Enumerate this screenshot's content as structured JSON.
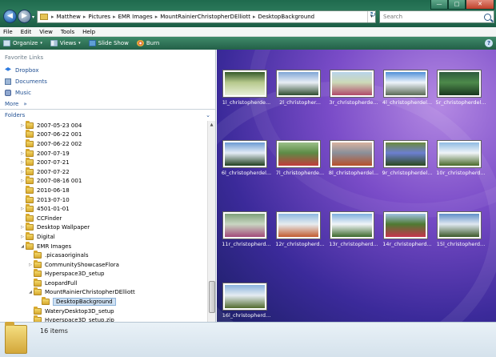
{
  "window": {
    "min_label": "—",
    "max_label": "□",
    "close_label": "✕"
  },
  "nav": {
    "back_glyph": "◀",
    "forward_glyph": "▶",
    "dropdown_glyph": "▾"
  },
  "address": {
    "crumbs": [
      "Matthew",
      "Pictures",
      "EMR Images",
      "MountRainierChristopherDElliott",
      "DesktopBackground"
    ],
    "separator": "▸",
    "dropdown_glyph": "▾",
    "refresh_glyph": "↻"
  },
  "search": {
    "placeholder": "Search"
  },
  "menu": {
    "items": [
      "File",
      "Edit",
      "View",
      "Tools",
      "Help"
    ]
  },
  "toolbar": {
    "organize": "Organize",
    "views": "Views",
    "slideshow": "Slide Show",
    "burn": "Burn",
    "arrow": "▾",
    "help": "?"
  },
  "favorites": {
    "header": "Favorite Links",
    "items": [
      {
        "label": "Dropbox",
        "icon": "dropbox-icon"
      },
      {
        "label": "Documents",
        "icon": "documents-icon"
      },
      {
        "label": "Music",
        "icon": "music-icon"
      }
    ],
    "more": "More",
    "more_arrow": "»"
  },
  "folders": {
    "header": "Folders",
    "chevron": "⌄",
    "tree": [
      {
        "label": "2007-05-23 004",
        "depth": 2,
        "expander": "▷"
      },
      {
        "label": "2007-06-22 001",
        "depth": 2,
        "expander": ""
      },
      {
        "label": "2007-06-22 002",
        "depth": 2,
        "expander": ""
      },
      {
        "label": "2007-07-19",
        "depth": 2,
        "expander": "▷"
      },
      {
        "label": "2007-07-21",
        "depth": 2,
        "expander": "▷"
      },
      {
        "label": "2007-07-22",
        "depth": 2,
        "expander": "▷"
      },
      {
        "label": "2007-08-16 001",
        "depth": 2,
        "expander": "▷"
      },
      {
        "label": "2010-06-18",
        "depth": 2,
        "expander": ""
      },
      {
        "label": "2013-07-10",
        "depth": 2,
        "expander": ""
      },
      {
        "label": "4501-01-01",
        "depth": 2,
        "expander": "▷"
      },
      {
        "label": "CCFinder",
        "depth": 2,
        "expander": ""
      },
      {
        "label": "Desktop Wallpaper",
        "depth": 2,
        "expander": "▷"
      },
      {
        "label": "Digital",
        "depth": 2,
        "expander": "▷"
      },
      {
        "label": "EMR Images",
        "depth": 2,
        "expander": "◢"
      },
      {
        "label": ".picasaoriginals",
        "depth": 3,
        "expander": ""
      },
      {
        "label": "CommunityShowcaseFlora",
        "depth": 3,
        "expander": "▷"
      },
      {
        "label": "Hyperspace3D_setup",
        "depth": 3,
        "expander": ""
      },
      {
        "label": "LeopardFull",
        "depth": 3,
        "expander": ""
      },
      {
        "label": "MountRainierChristopherDElliott",
        "depth": 3,
        "expander": "◢"
      },
      {
        "label": "DesktopBackground",
        "depth": 4,
        "expander": "",
        "selected": true
      },
      {
        "label": "WateryDesktop3D_setup",
        "depth": 3,
        "expander": ""
      },
      {
        "label": "Hyperspace3D_setup.zip",
        "depth": 3,
        "expander": ""
      }
    ],
    "scroll_up": "▲"
  },
  "files": [
    {
      "label": "1l_christopherde...",
      "colors": [
        "#355a2a",
        "#b7c98d",
        "#e8efd8"
      ]
    },
    {
      "label": "2l_christopher...",
      "colors": [
        "#7fa6d6",
        "#e9eef5",
        "#2f4d2f"
      ]
    },
    {
      "label": "3r_christopherde...",
      "colors": [
        "#b8d3ea",
        "#cdd9b7",
        "#b04a6a"
      ]
    },
    {
      "label": "4l_christopherdel...",
      "colors": [
        "#4f8fd8",
        "#eef4fb",
        "#5a6a55"
      ]
    },
    {
      "label": "5r_christopherdel...",
      "colors": [
        "#2e5b3d",
        "#4d8a4a",
        "#19371f"
      ]
    },
    {
      "label": "6l_christopherdel...",
      "colors": [
        "#6c9bd3",
        "#e4ecf6",
        "#21401f"
      ]
    },
    {
      "label": "7l_christopherde...",
      "colors": [
        "#9bc08a",
        "#5d8b46",
        "#c23c3c"
      ]
    },
    {
      "label": "8l_christopherdel...",
      "colors": [
        "#d8b3a0",
        "#8a8f9a",
        "#b8502a"
      ]
    },
    {
      "label": "9r_christopherdel...",
      "colors": [
        "#6b8a3e",
        "#6c7fd0",
        "#2c4a1e"
      ]
    },
    {
      "label": "10r_christopherd...",
      "colors": [
        "#8fbbe3",
        "#f0f4f8",
        "#4a6a2a"
      ]
    },
    {
      "label": "11r_christopherd...",
      "colors": [
        "#7ea07a",
        "#c9d6c2",
        "#a24a7a"
      ]
    },
    {
      "label": "12r_christopherd...",
      "colors": [
        "#8db8e0",
        "#e7ecef",
        "#c25c2f"
      ]
    },
    {
      "label": "13r_christopherd...",
      "colors": [
        "#7dafde",
        "#f1f5f8",
        "#3d6a2c"
      ]
    },
    {
      "label": "14r_christopherd...",
      "colors": [
        "#9fc2e3",
        "#4f7a32",
        "#c6354c"
      ]
    },
    {
      "label": "15l_christopherd...",
      "colors": [
        "#5f8fc8",
        "#dfe8f1",
        "#3d5a2a"
      ]
    },
    {
      "label": "16l_christopherd...",
      "colors": [
        "#8ab2dd",
        "#e5ecf2",
        "#526b2e"
      ]
    }
  ],
  "details": {
    "count": "16 items"
  },
  "colors": {
    "chrome": "#2c7a5b",
    "link": "#1f4f93"
  }
}
